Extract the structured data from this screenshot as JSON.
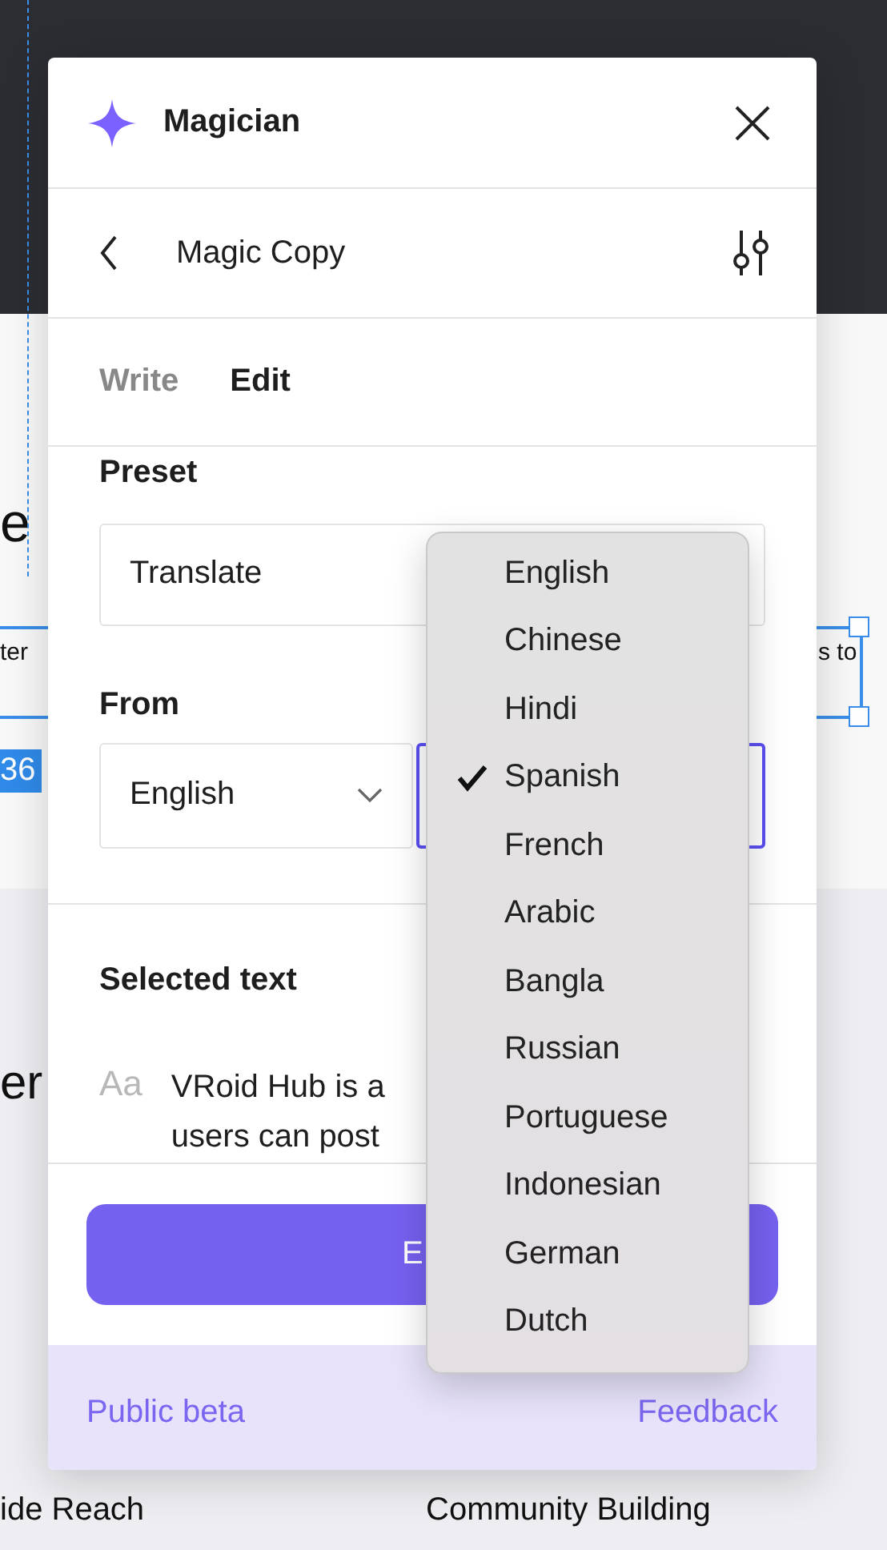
{
  "canvas": {
    "left_texts": [
      "e",
      "ter",
      "er"
    ],
    "badge": "36",
    "right_text": "s to",
    "bottom_texts": [
      "ide Reach",
      "Community Building"
    ]
  },
  "panel": {
    "title": "Magician",
    "subtitle": "Magic Copy",
    "tabs": [
      {
        "label": "Write",
        "selected": false
      },
      {
        "label": "Edit",
        "selected": true
      }
    ],
    "preset": {
      "label": "Preset",
      "value": "Translate"
    },
    "from": {
      "label": "From",
      "value": "English"
    },
    "to": {
      "focused": true
    },
    "selected_text": {
      "label": "Selected text",
      "icon_text": "Aa",
      "lines": [
        "VRoid Hub is a",
        "users can post"
      ]
    },
    "primary_button": "E",
    "footer": {
      "status": "Public beta",
      "link": "Feedback"
    }
  },
  "language_menu": [
    {
      "label": "English",
      "selected": false
    },
    {
      "label": "Chinese",
      "selected": false
    },
    {
      "label": "Hindi",
      "selected": false
    },
    {
      "label": "Spanish",
      "selected": true
    },
    {
      "label": "French",
      "selected": false
    },
    {
      "label": "Arabic",
      "selected": false
    },
    {
      "label": "Bangla",
      "selected": false
    },
    {
      "label": "Russian",
      "selected": false
    },
    {
      "label": "Portuguese",
      "selected": false
    },
    {
      "label": "Indonesian",
      "selected": false
    },
    {
      "label": "German",
      "selected": false
    },
    {
      "label": "Dutch",
      "selected": false
    }
  ]
}
